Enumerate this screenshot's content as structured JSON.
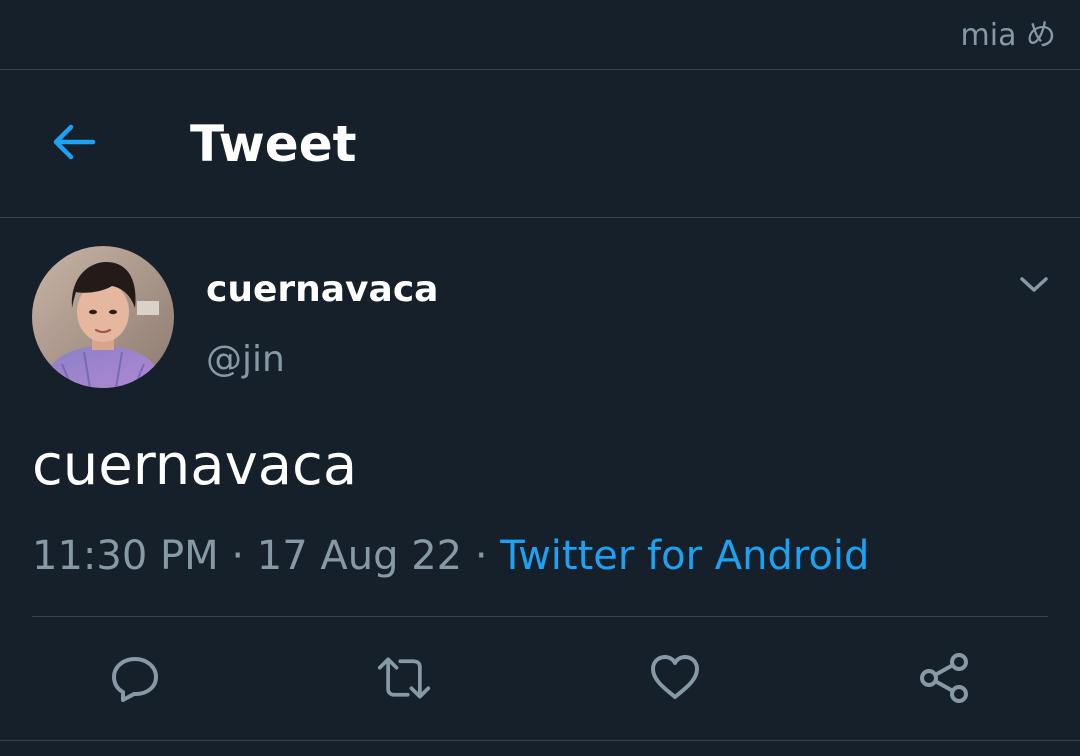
{
  "watermark": "mia め",
  "header": {
    "title": "Tweet",
    "back_icon": "arrow-left-icon"
  },
  "tweet": {
    "author": {
      "display_name": "cuernavaca",
      "handle": "@jin"
    },
    "text": "cuernavaca",
    "time": "11:30 PM",
    "separator": " · ",
    "date": "17 Aug 22",
    "source": "Twitter for Android"
  },
  "actions": [
    {
      "icon": "reply-icon"
    },
    {
      "icon": "retweet-icon"
    },
    {
      "icon": "like-icon"
    },
    {
      "icon": "share-icon"
    }
  ],
  "colors": {
    "background": "#15202b",
    "accent": "#1da1f2",
    "secondary_text": "#8899a6",
    "divider": "#38444d"
  }
}
